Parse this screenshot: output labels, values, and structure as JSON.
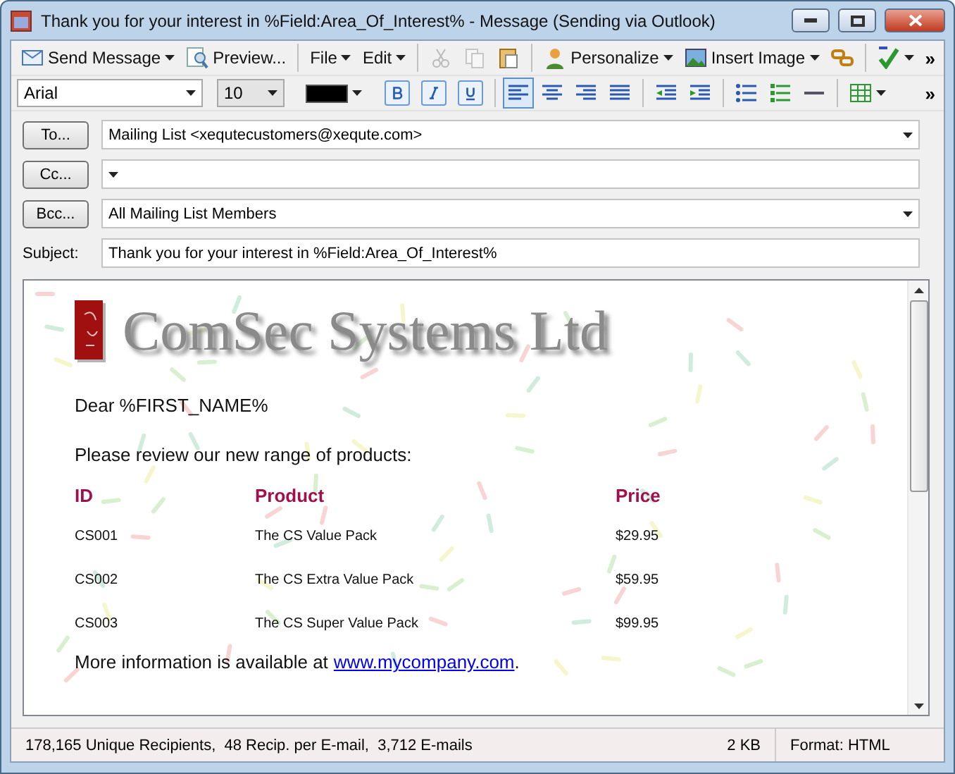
{
  "window": {
    "title": "Thank you for your interest in %Field:Area_Of_Interest% - Message (Sending via Outlook)"
  },
  "toolbar": {
    "groups": [
      [
        {
          "kind": "send",
          "label": "Send Message",
          "dropdown": true,
          "disabled": false
        },
        {
          "kind": "preview",
          "label": "Preview...",
          "dropdown": false,
          "disabled": false
        }
      ],
      [
        {
          "kind": "menu",
          "label": "File",
          "dropdown": true,
          "disabled": false
        },
        {
          "kind": "menu",
          "label": "Edit",
          "dropdown": true,
          "disabled": false
        }
      ],
      [
        {
          "kind": "cut",
          "dropdown": false,
          "disabled": true
        },
        {
          "kind": "copy",
          "dropdown": false,
          "disabled": true
        },
        {
          "kind": "paste",
          "dropdown": false,
          "disabled": false
        }
      ],
      [
        {
          "kind": "personalize",
          "label": "Personalize",
          "dropdown": true,
          "disabled": false
        },
        {
          "kind": "image",
          "label": "Insert Image",
          "dropdown": true,
          "disabled": false
        },
        {
          "kind": "link",
          "dropdown": false,
          "disabled": false
        }
      ],
      [
        {
          "kind": "spellcheck",
          "dropdown": true,
          "disabled": false
        }
      ]
    ],
    "overflow": "»"
  },
  "format_bar": {
    "font": "Arial",
    "size": "10",
    "overflow": "»",
    "styles": [
      {
        "kind": "bold",
        "selected": false
      },
      {
        "kind": "italic",
        "selected": false
      },
      {
        "kind": "underline",
        "selected": false
      }
    ],
    "alignment": [
      {
        "kind": "left",
        "selected": true
      },
      {
        "kind": "center",
        "selected": false
      },
      {
        "kind": "right",
        "selected": false
      },
      {
        "kind": "justify",
        "selected": false
      }
    ],
    "tools": [
      {
        "kind": "outdent"
      },
      {
        "kind": "indent"
      },
      {
        "kind": "bullets"
      },
      {
        "kind": "numbering"
      },
      {
        "kind": "rule"
      }
    ]
  },
  "recipients": [
    {
      "label": "To...",
      "value": "Mailing List <xequtecustomers@xequte.com>"
    },
    {
      "label": "Cc..."
    },
    {
      "label": "Bcc...",
      "value": "All Mailing List Members"
    }
  ],
  "subject": {
    "label": "Subject:",
    "value": "Thank you for your interest in %Field:Area_Of_Interest%"
  },
  "body": {
    "logo_text": "ComSec Systems Ltd",
    "greeting": "Dear %FIRST_NAME%",
    "intro": "Please review our new range of products:",
    "table": {
      "columns": [
        "ID",
        "Product",
        "Price"
      ],
      "rows": [
        [
          "CS001",
          "The CS Value Pack",
          "$29.95"
        ],
        [
          "CS002",
          "The CS Extra Value Pack",
          "$59.95"
        ],
        [
          "CS003",
          "The CS Super Value Pack",
          "$99.95"
        ]
      ]
    },
    "footer": {
      "text": "More information is available at",
      "link": "www.mycompany.com",
      "end": "."
    }
  },
  "status_bar": {
    "summary": "178,165 Unique Recipients,  48 Recip. per E-mail,  3,712 E-mails",
    "size": "2 KB",
    "format": "Format: HTML"
  }
}
